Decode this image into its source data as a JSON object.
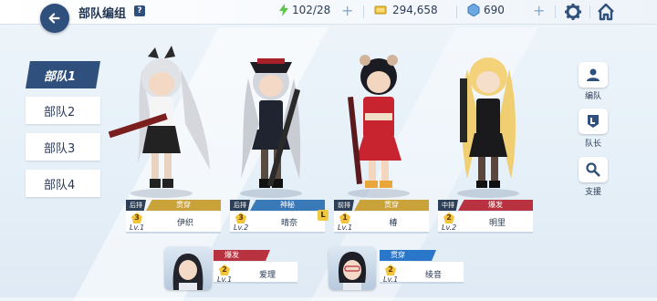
{
  "header": {
    "title": "部队编组",
    "help_icon": "question-icon",
    "ap_value": "102/28",
    "credits_value": "294,658",
    "gems_value": "690"
  },
  "colors": {
    "navy": "#2f4f7d",
    "gold": "#f2c33b",
    "penetration": "#c9a23a",
    "mystic": "#3a79b8",
    "explosive": "#b8323f",
    "striker_tag": "#2e3f58",
    "special_tag": "#2a76c9"
  },
  "sidebar": {
    "tabs": [
      {
        "label": "部队1",
        "active": true
      },
      {
        "label": "部队2",
        "active": false
      },
      {
        "label": "部队3",
        "active": false
      },
      {
        "label": "部队4",
        "active": false
      }
    ]
  },
  "actions": [
    {
      "label": "编队",
      "icon": "formation-icon"
    },
    {
      "label": "队长",
      "icon": "leader-icon"
    },
    {
      "label": "支援",
      "icon": "search-support-icon"
    }
  ],
  "strikers": [
    {
      "position": "后排",
      "class": "贯穿",
      "stars": "3",
      "level": "Lv.1",
      "name": "伊织"
    },
    {
      "position": "后排",
      "class": "神秘",
      "stars": "3",
      "level": "Lv.2",
      "name": "晴奈"
    },
    {
      "position": "前排",
      "class": "贯穿",
      "stars": "1",
      "level": "Lv.1",
      "name": "椿"
    },
    {
      "position": "中排",
      "class": "爆发",
      "stars": "2",
      "level": "Lv.2",
      "name": "明里"
    }
  ],
  "leader_badge": "L",
  "specials": [
    {
      "class": "爆发",
      "stars": "2",
      "level": "Lv.1",
      "name": "爱理"
    },
    {
      "class": "贯穿",
      "stars": "2",
      "level": "Lv.1",
      "name": "绫音"
    }
  ]
}
